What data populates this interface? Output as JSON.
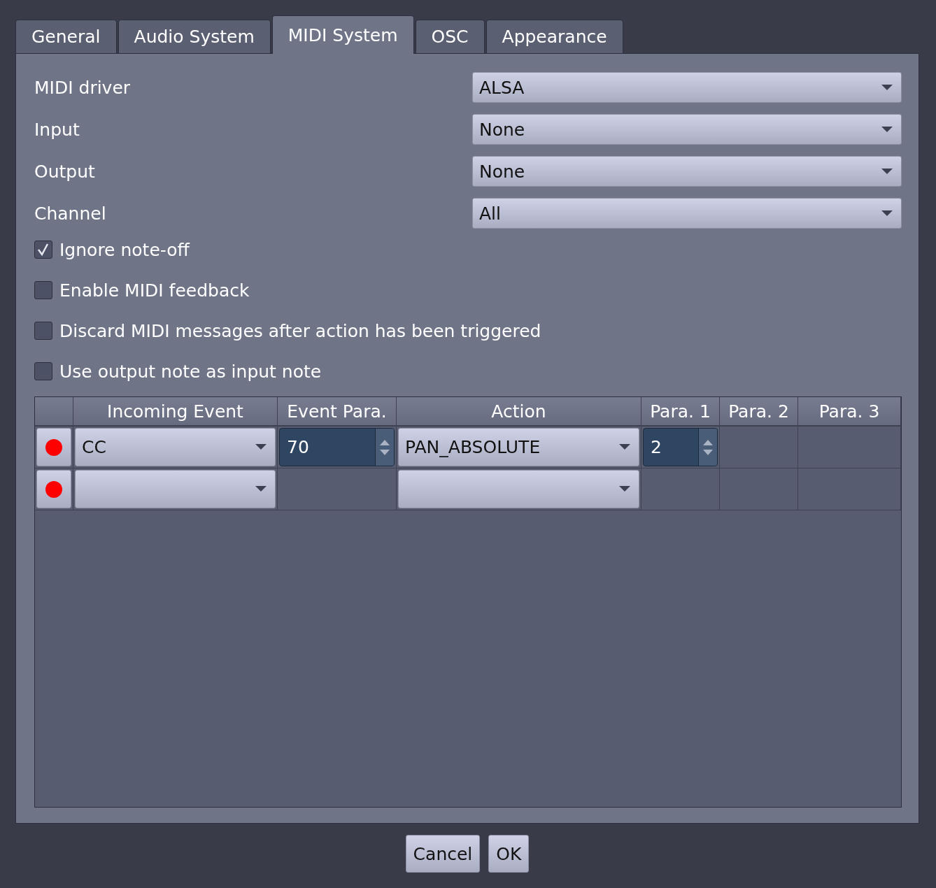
{
  "tabs": [
    {
      "label": "General",
      "selected": false
    },
    {
      "label": "Audio System",
      "selected": false
    },
    {
      "label": "MIDI System",
      "selected": true
    },
    {
      "label": "OSC",
      "selected": false
    },
    {
      "label": "Appearance",
      "selected": false
    }
  ],
  "settings": [
    {
      "label": "MIDI driver",
      "value": "ALSA"
    },
    {
      "label": "Input",
      "value": "None"
    },
    {
      "label": "Output",
      "value": "None"
    },
    {
      "label": "Channel",
      "value": "All"
    }
  ],
  "options": [
    {
      "label": "Ignore note-off",
      "checked": true
    },
    {
      "label": "Enable MIDI feedback",
      "checked": false
    },
    {
      "label": "Discard MIDI messages after action has been triggered",
      "checked": false
    },
    {
      "label": "Use output note as input note",
      "checked": false
    }
  ],
  "table": {
    "columns": [
      "Incoming Event",
      "Event Para.",
      "Action",
      "Para. 1",
      "Para. 2",
      "Para. 3"
    ],
    "rows": [
      {
        "cells": [
          {
            "kind": "combo",
            "value": "CC"
          },
          {
            "kind": "spin",
            "value": "70"
          },
          {
            "kind": "combo",
            "value": "PAN_ABSOLUTE"
          },
          {
            "kind": "spin",
            "value": "2"
          },
          {
            "kind": "empty"
          },
          {
            "kind": "empty"
          }
        ]
      },
      {
        "cells": [
          {
            "kind": "combo"
          },
          {
            "kind": "empty"
          },
          {
            "kind": "combo"
          },
          {
            "kind": "empty"
          },
          {
            "kind": "empty"
          },
          {
            "kind": "empty"
          }
        ]
      }
    ]
  },
  "buttons": [
    "Cancel",
    "OK"
  ]
}
